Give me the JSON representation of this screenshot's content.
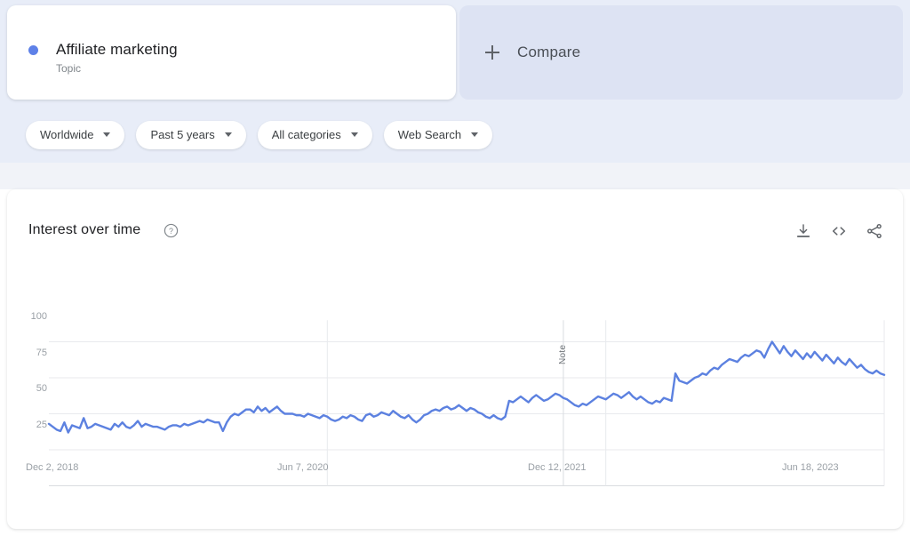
{
  "header": {
    "query": {
      "term": "Affiliate marketing",
      "type_label": "Topic",
      "dot_color": "#5e81e8"
    },
    "compare": {
      "label": "Compare",
      "icon": "plus-icon"
    }
  },
  "filters": [
    {
      "label": "Worldwide",
      "name": "location"
    },
    {
      "label": "Past 5 years",
      "name": "time-range"
    },
    {
      "label": "All categories",
      "name": "category"
    },
    {
      "label": "Web Search",
      "name": "search-type"
    }
  ],
  "card": {
    "title": "Interest over time",
    "help_icon": "help-circle-icon",
    "tools": [
      {
        "name": "download-icon",
        "label": "download"
      },
      {
        "name": "embed-code-icon",
        "label": "embed"
      },
      {
        "name": "share-icon",
        "label": "share"
      }
    ]
  },
  "chart_data": {
    "type": "line",
    "title": "Interest over time",
    "xlabel": "",
    "ylabel": "",
    "ylim": [
      0,
      100
    ],
    "yticks": [
      100,
      75,
      50,
      25
    ],
    "xticks": [
      "Dec 2, 2018",
      "Jun 7, 2020",
      "Dec 12, 2021",
      "Jun 18, 2023"
    ],
    "xtick_positions": [
      0,
      0.3333,
      0.6667,
      1.0
    ],
    "grid": true,
    "legend": "none",
    "line_color": "#5c81e0",
    "annotations": [
      {
        "label": "Note",
        "x_fraction": 0.6159,
        "orientation": "vertical"
      }
    ],
    "series": [
      {
        "name": "Affiliate marketing",
        "color": "#5c81e0",
        "values": [
          43,
          41,
          39,
          38,
          44,
          37,
          42,
          41,
          40,
          47,
          40,
          41,
          43,
          42,
          41,
          40,
          39,
          43,
          41,
          44,
          41,
          40,
          42,
          45,
          41,
          43,
          42,
          41,
          41,
          40,
          39,
          41,
          42,
          42,
          41,
          43,
          42,
          43,
          44,
          45,
          44,
          46,
          45,
          44,
          44,
          38,
          44,
          48,
          50,
          49,
          51,
          53,
          53,
          51,
          55,
          52,
          54,
          51,
          53,
          55,
          52,
          50,
          50,
          50,
          49,
          49,
          48,
          50,
          49,
          48,
          47,
          49,
          48,
          46,
          45,
          46,
          48,
          47,
          49,
          48,
          46,
          45,
          49,
          50,
          48,
          49,
          51,
          50,
          49,
          52,
          50,
          48,
          47,
          49,
          46,
          44,
          46,
          49,
          50,
          52,
          53,
          52,
          54,
          55,
          53,
          54,
          56,
          54,
          52,
          54,
          53,
          51,
          50,
          48,
          47,
          49,
          47,
          46,
          48,
          59,
          58,
          60,
          62,
          60,
          58,
          61,
          63,
          61,
          59,
          60,
          62,
          64,
          63,
          61,
          60,
          58,
          56,
          55,
          57,
          56,
          58,
          60,
          62,
          61,
          60,
          62,
          64,
          63,
          61,
          63,
          65,
          62,
          60,
          62,
          60,
          58,
          57,
          59,
          58,
          61,
          60,
          59,
          78,
          73,
          72,
          71,
          73,
          75,
          76,
          78,
          77,
          80,
          82,
          81,
          84,
          86,
          88,
          87,
          86,
          89,
          91,
          90,
          92,
          94,
          93,
          89,
          95,
          100,
          96,
          92,
          97,
          93,
          90,
          94,
          91,
          88,
          92,
          89,
          93,
          90,
          87,
          91,
          88,
          85,
          89,
          86,
          84,
          88,
          85,
          82,
          84,
          81,
          79,
          78,
          80,
          78,
          77
        ]
      }
    ]
  }
}
